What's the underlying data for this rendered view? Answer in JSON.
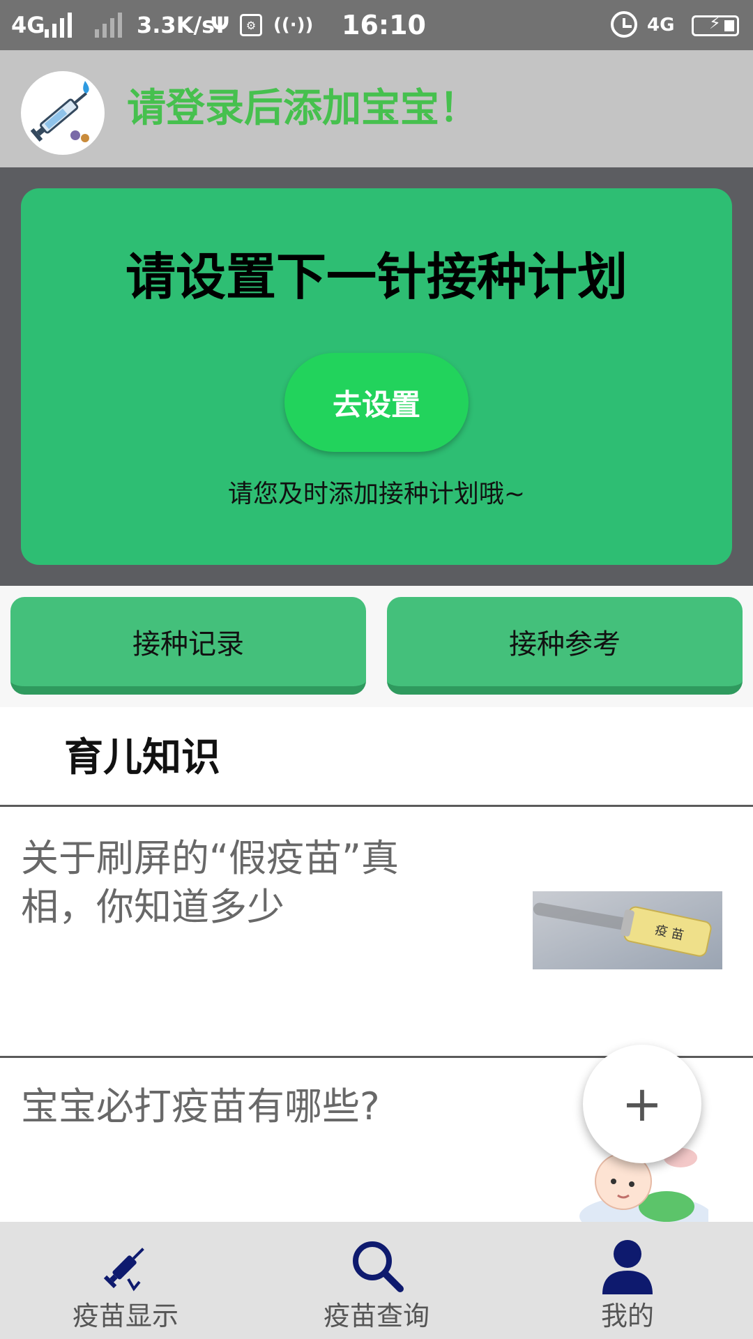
{
  "status_bar": {
    "network": "4G",
    "speed": "3.3K/s",
    "time": "16:10",
    "network_right": "4G"
  },
  "header": {
    "title": "请登录后添加宝宝！"
  },
  "plan_card": {
    "title": "请设置下一针接种计划",
    "button_label": "去设置",
    "subtitle": "请您及时添加接种计划哦~"
  },
  "actions": {
    "record_label": "接种记录",
    "reference_label": "接种参考"
  },
  "knowledge": {
    "section_title": "育儿知识",
    "articles": [
      {
        "title": "关于刷屏的“假疫苗”真相，你知道多少"
      },
      {
        "title": "宝宝必打疫苗有哪些?"
      }
    ]
  },
  "fab": {
    "symbol": "+"
  },
  "bottom_nav": {
    "items": [
      {
        "label": "疫苗显示",
        "icon": "syringe-icon"
      },
      {
        "label": "疫苗查询",
        "icon": "search-icon"
      },
      {
        "label": "我的",
        "icon": "user-icon"
      }
    ]
  },
  "colors": {
    "header_title": "#46c04e",
    "plan_card": "#2ebe73",
    "plan_button": "#22d35c",
    "action_button": "#44c07b",
    "nav_icon": "#0e1a6e"
  }
}
